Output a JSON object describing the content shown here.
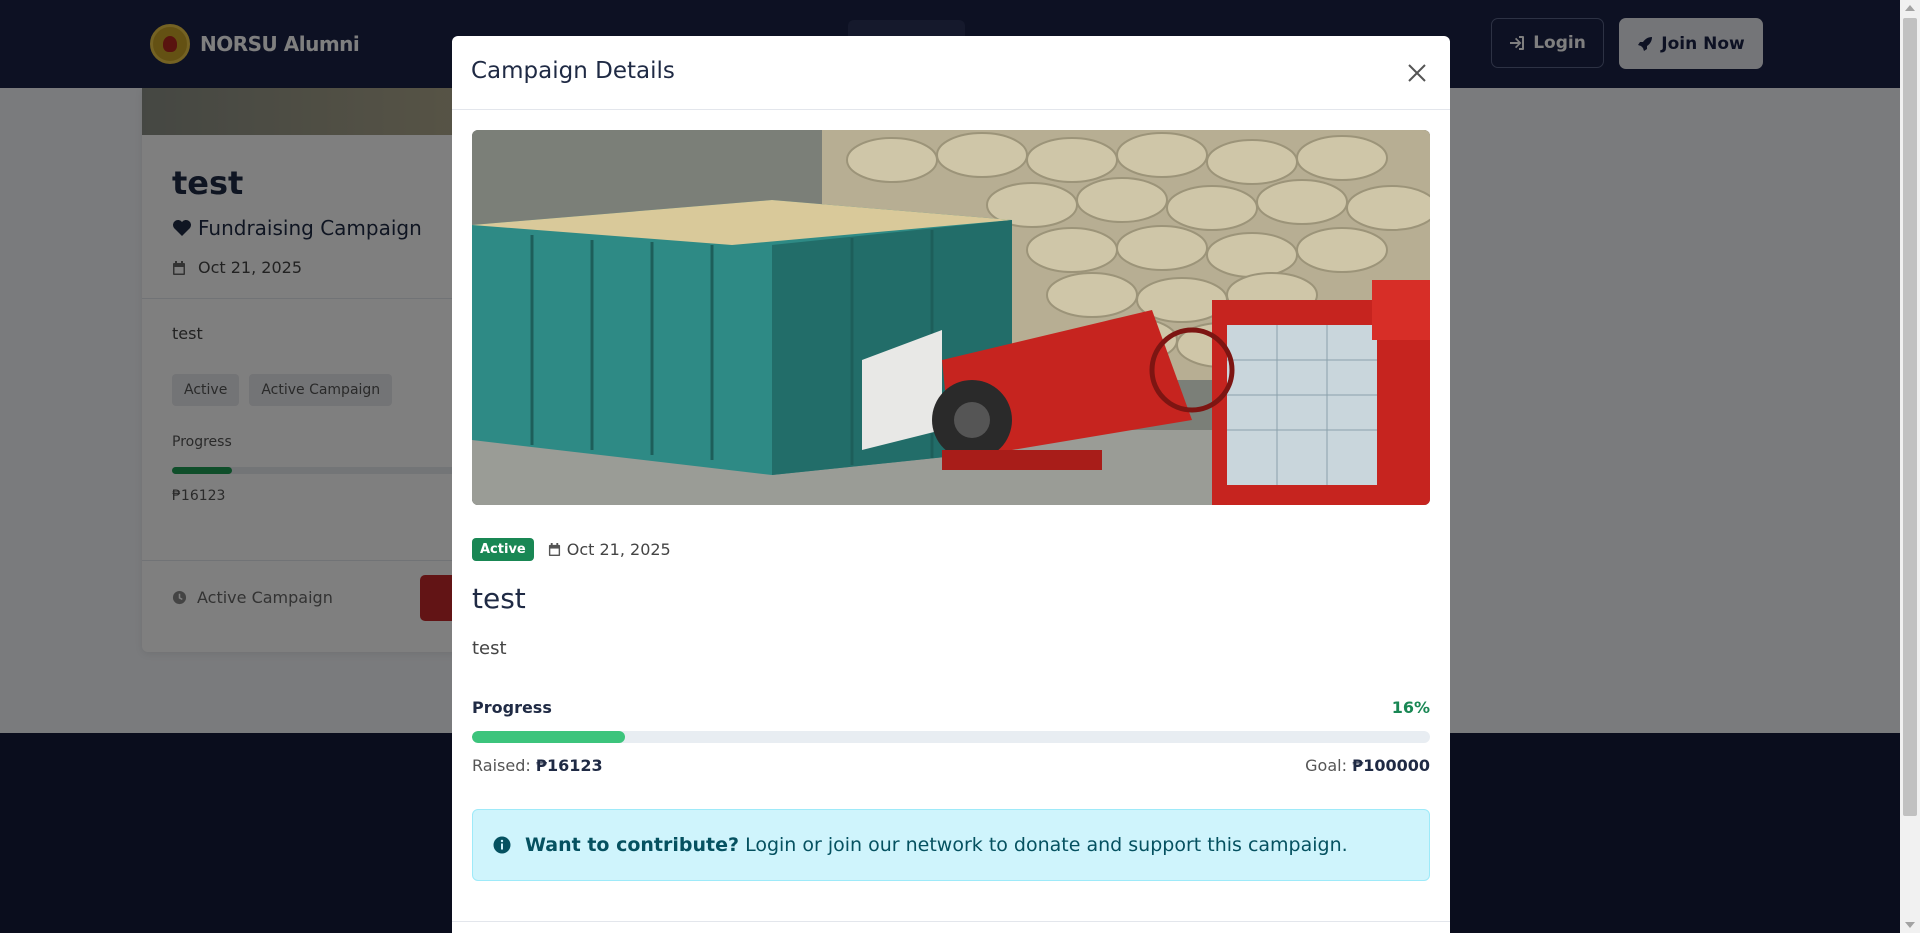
{
  "navbar": {
    "brand_name": "NORSU Alumni",
    "login_label": "Login",
    "join_label": "Join Now"
  },
  "background_card": {
    "title": "test",
    "type_label": "Fundraising Campaign",
    "date": "Oct 21, 2025",
    "description": "test",
    "tags": [
      "Active",
      "Active Campaign"
    ],
    "progress_label": "Progress",
    "progress_percent": 7.5,
    "raised": "₱16123",
    "status_label": "Active Campaign"
  },
  "modal": {
    "title": "Campaign Details",
    "status_badge": "Active",
    "date": "Oct 21, 2025",
    "campaign_title": "test",
    "description": "test",
    "progress_label": "Progress",
    "progress_percent_text": "16%",
    "progress_percent": 16,
    "raised_label": "Raised:",
    "raised_value": "₱16123",
    "goal_label": "Goal:",
    "goal_value": "₱100000",
    "alert_strong": "Want to contribute?",
    "alert_text": "Login or join our network to donate and support this campaign."
  },
  "colors": {
    "navbar": "#1b2347",
    "success": "#198754",
    "progress_fill": "#3cc47c",
    "alert_bg": "#cff4fc",
    "alert_text": "#055160"
  },
  "icons": [
    "sign-in-icon",
    "rocket-icon",
    "heart-icon",
    "calendar-icon",
    "clock-icon",
    "close-icon",
    "info-circle-icon"
  ]
}
